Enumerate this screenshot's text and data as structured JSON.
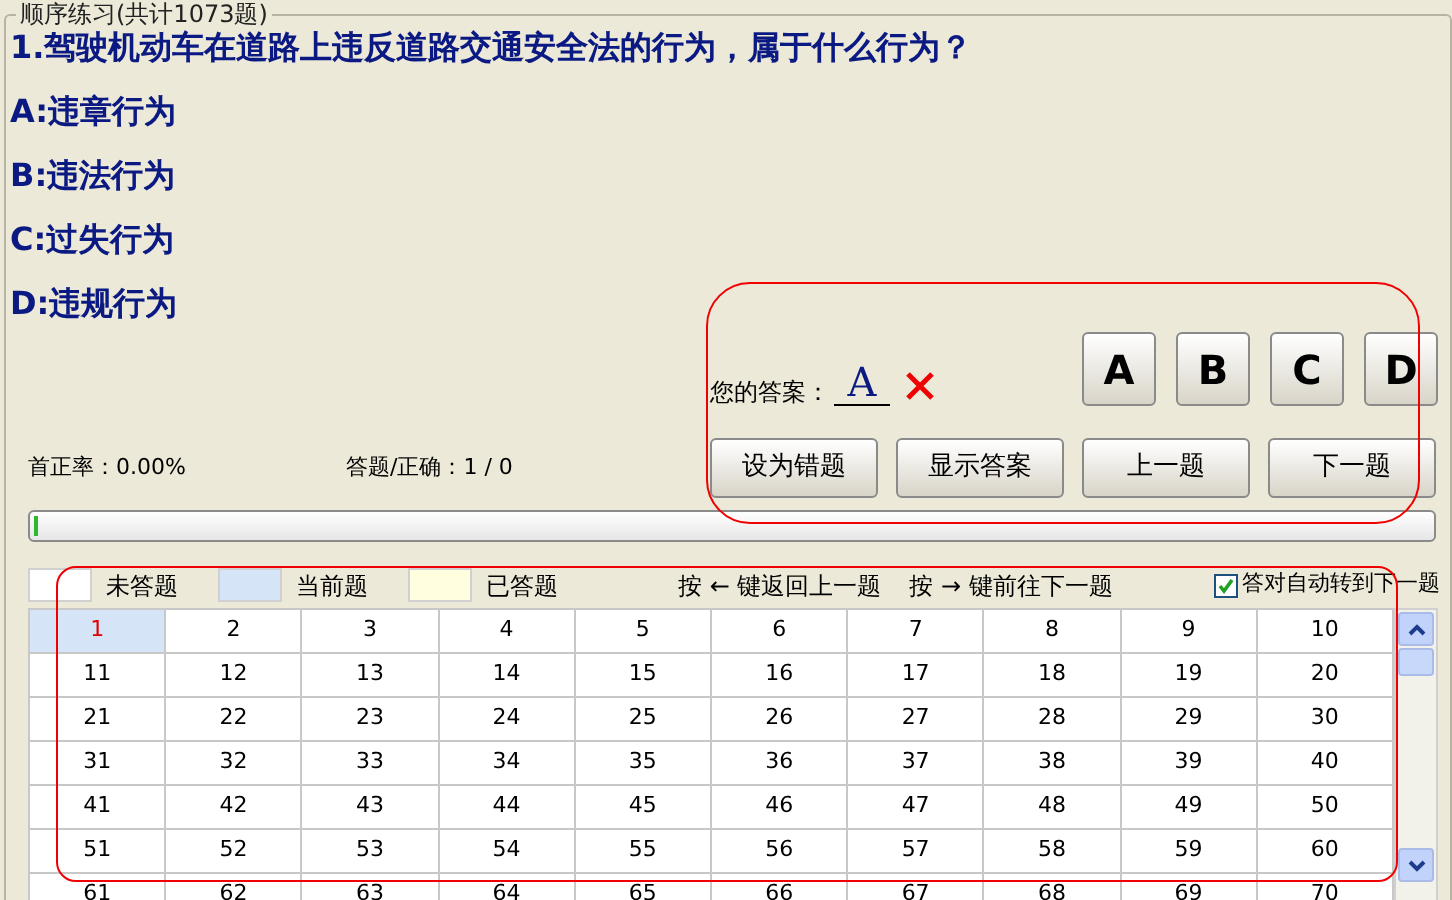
{
  "group_title": "顺序练习(共计1073题)",
  "question": "1.驾驶机动车在道路上违反道路交通安全法的行为，属于什么行为？",
  "options": [
    "A:违章行为",
    "B:违法行为",
    "C:过失行为",
    "D:违规行为"
  ],
  "answer": {
    "label": "您的答案：",
    "value": "A",
    "correct": false
  },
  "choice_buttons": [
    "A",
    "B",
    "C",
    "D"
  ],
  "action_buttons": [
    "设为错题",
    "显示答案",
    "上一题",
    "下一题"
  ],
  "stats": {
    "first_rate": "首正率：0.00%",
    "answered": "答题/正确：1 / 0"
  },
  "progress": {
    "level": 0.003
  },
  "legend": [
    {
      "label": "未答题",
      "color": "#ffffff"
    },
    {
      "label": "当前题",
      "color": "#d6e4f7"
    },
    {
      "label": "已答题",
      "color": "#ffffe0"
    }
  ],
  "hints": [
    "按 ← 键返回上一题",
    "按 → 键前往下一题"
  ],
  "auto_next": {
    "label": "答对自动转到下一题",
    "checked": true
  },
  "grid": [
    [
      {
        "text": "1",
        "selected": true
      },
      {
        "text": "2",
        "selected": false
      },
      {
        "text": "3",
        "selected": false
      },
      {
        "text": "4",
        "selected": false
      },
      {
        "text": "5",
        "selected": false
      },
      {
        "text": "6",
        "selected": false
      },
      {
        "text": "7",
        "selected": false
      },
      {
        "text": "8",
        "selected": false
      },
      {
        "text": "9",
        "selected": false
      },
      {
        "text": "10",
        "selected": false
      }
    ],
    [
      {
        "text": "11",
        "selected": false
      },
      {
        "text": "12",
        "selected": false
      },
      {
        "text": "13",
        "selected": false
      },
      {
        "text": "14",
        "selected": false
      },
      {
        "text": "15",
        "selected": false
      },
      {
        "text": "16",
        "selected": false
      },
      {
        "text": "17",
        "selected": false
      },
      {
        "text": "18",
        "selected": false
      },
      {
        "text": "19",
        "selected": false
      },
      {
        "text": "20",
        "selected": false
      }
    ],
    [
      {
        "text": "21",
        "selected": false
      },
      {
        "text": "22",
        "selected": false
      },
      {
        "text": "23",
        "selected": false
      },
      {
        "text": "24",
        "selected": false
      },
      {
        "text": "25",
        "selected": false
      },
      {
        "text": "26",
        "selected": false
      },
      {
        "text": "27",
        "selected": false
      },
      {
        "text": "28",
        "selected": false
      },
      {
        "text": "29",
        "selected": false
      },
      {
        "text": "30",
        "selected": false
      }
    ],
    [
      {
        "text": "31",
        "selected": false
      },
      {
        "text": "32",
        "selected": false
      },
      {
        "text": "33",
        "selected": false
      },
      {
        "text": "34",
        "selected": false
      },
      {
        "text": "35",
        "selected": false
      },
      {
        "text": "36",
        "selected": false
      },
      {
        "text": "37",
        "selected": false
      },
      {
        "text": "38",
        "selected": false
      },
      {
        "text": "39",
        "selected": false
      },
      {
        "text": "40",
        "selected": false
      }
    ],
    [
      {
        "text": "41",
        "selected": false
      },
      {
        "text": "42",
        "selected": false
      },
      {
        "text": "43",
        "selected": false
      },
      {
        "text": "44",
        "selected": false
      },
      {
        "text": "45",
        "selected": false
      },
      {
        "text": "46",
        "selected": false
      },
      {
        "text": "47",
        "selected": false
      },
      {
        "text": "48",
        "selected": false
      },
      {
        "text": "49",
        "selected": false
      },
      {
        "text": "50",
        "selected": false
      }
    ],
    [
      {
        "text": "51",
        "selected": false
      },
      {
        "text": "52",
        "selected": false
      },
      {
        "text": "53",
        "selected": false
      },
      {
        "text": "54",
        "selected": false
      },
      {
        "text": "55",
        "selected": false
      },
      {
        "text": "56",
        "selected": false
      },
      {
        "text": "57",
        "selected": false
      },
      {
        "text": "58",
        "selected": false
      },
      {
        "text": "59",
        "selected": false
      },
      {
        "text": "60",
        "selected": false
      }
    ],
    [
      {
        "text": "61",
        "selected": false
      },
      {
        "text": "62",
        "selected": false
      },
      {
        "text": "63",
        "selected": false
      },
      {
        "text": "64",
        "selected": false
      },
      {
        "text": "65",
        "selected": false
      },
      {
        "text": "66",
        "selected": false
      },
      {
        "text": "67",
        "selected": false
      },
      {
        "text": "68",
        "selected": false
      },
      {
        "text": "69",
        "selected": false
      },
      {
        "text": "70",
        "selected": false
      }
    ]
  ]
}
